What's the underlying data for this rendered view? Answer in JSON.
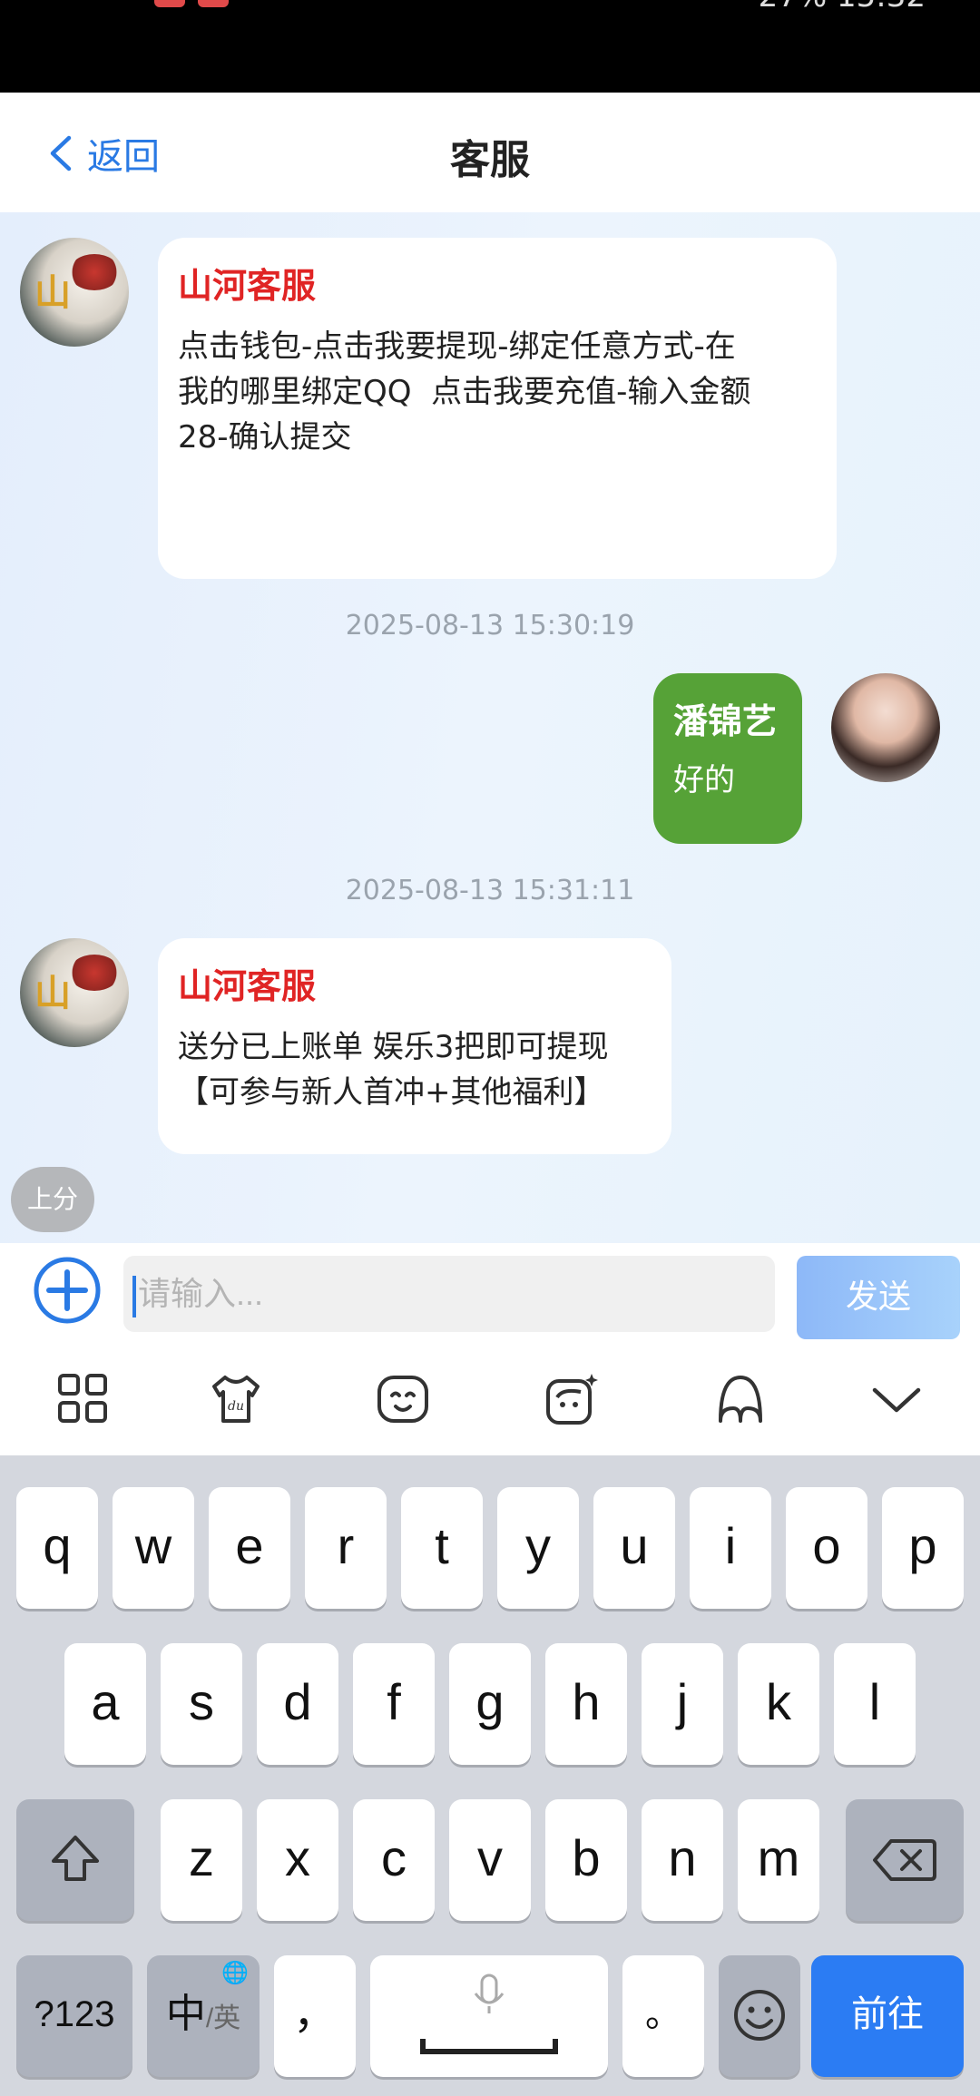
{
  "status_bar": {
    "right_text": "27% 15:32"
  },
  "header": {
    "back_label": "返回",
    "title": "客服"
  },
  "messages": [
    {
      "sender": "山河客服",
      "text": "点击钱包-点击我要提现-绑定任意方式-在\n我的哪里绑定QQ  点击我要充值-输入金额\n28-确认提交"
    },
    {
      "time": "2025-08-13 15:30:19"
    },
    {
      "sender": "潘锦艺",
      "text": "好的"
    },
    {
      "time": "2025-08-13 15:31:11"
    },
    {
      "sender": "山河客服",
      "text": "送分已上账单 娱乐3把即可提现\n【可参与新人首冲+其他福利】"
    }
  ],
  "topup_button": "上分",
  "input": {
    "placeholder": "请输入...",
    "send_label": "发送"
  },
  "keyboard": {
    "toolbar_icons": [
      "apps-grid-icon",
      "tshirt-skin-icon",
      "emoji-face-icon",
      "sticker-face-icon",
      "handwriting-icon",
      "collapse-chevron-icon"
    ],
    "row1": [
      "q",
      "w",
      "e",
      "r",
      "t",
      "y",
      "u",
      "i",
      "o",
      "p"
    ],
    "row2": [
      "a",
      "s",
      "d",
      "f",
      "g",
      "h",
      "j",
      "k",
      "l"
    ],
    "row3": [
      "z",
      "x",
      "c",
      "v",
      "b",
      "n",
      "m"
    ],
    "numbers_key": "?123",
    "lang_key_main": "中",
    "lang_key_sub": "/英",
    "comma": "，",
    "period": "。",
    "enter_label": "前往"
  }
}
